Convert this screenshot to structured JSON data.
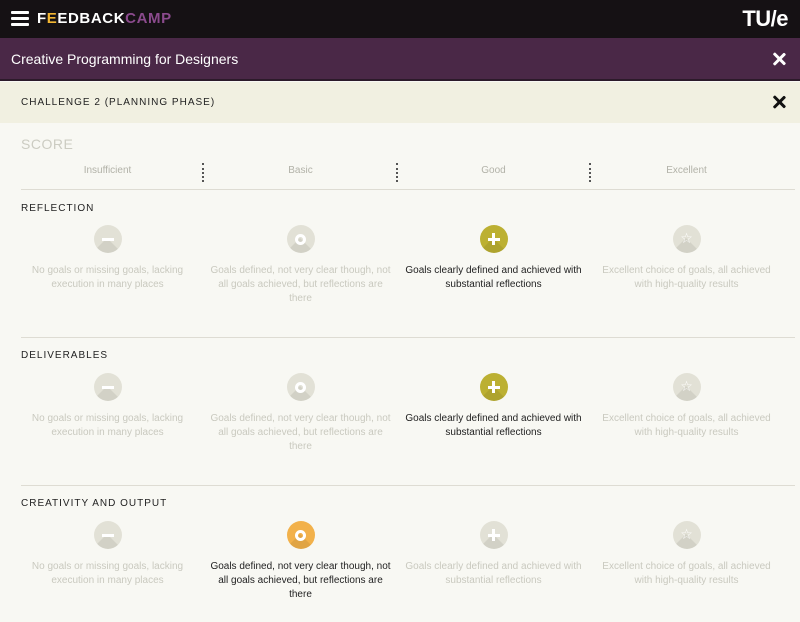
{
  "app": {
    "logo": [
      "F",
      "E",
      "EDBACK",
      "CAMP"
    ],
    "brand_right": "TU/e"
  },
  "course": {
    "title": "Creative Programming for Designers"
  },
  "challenge": {
    "title": "CHALLENGE 2 (PLANNING PHASE)"
  },
  "score": {
    "title": "SCORE",
    "levels": [
      "Insufficient",
      "Basic",
      "Good",
      "Excellent"
    ]
  },
  "criteria": [
    {
      "name": "REFLECTION",
      "selected": "Good",
      "options": [
        {
          "icon": "minus-icon",
          "text": "No goals or missing goals, lacking execution in many places"
        },
        {
          "icon": "ring-icon",
          "text": "Goals defined, not very clear though, not all goals achieved, but reflections are there"
        },
        {
          "icon": "plus-icon",
          "text": "Goals clearly defined and achieved with substantial reflections"
        },
        {
          "icon": "star-icon",
          "text": "Excellent choice of goals, all achieved with high-quality results"
        }
      ]
    },
    {
      "name": "DELIVERABLES",
      "selected": "Good",
      "options": [
        {
          "icon": "minus-icon",
          "text": "No goals or missing goals, lacking execution in many places"
        },
        {
          "icon": "ring-icon",
          "text": "Goals defined, not very clear though, not all goals achieved, but reflections are there"
        },
        {
          "icon": "plus-icon",
          "text": "Goals clearly defined and achieved with substantial reflections"
        },
        {
          "icon": "star-icon",
          "text": "Excellent choice of goals, all achieved with high-quality results"
        }
      ]
    },
    {
      "name": "CREATIVITY AND OUTPUT",
      "selected": "Basic",
      "options": [
        {
          "icon": "minus-icon",
          "text": "No goals or missing goals, lacking execution in many places"
        },
        {
          "icon": "ring-icon",
          "text": "Goals defined, not very clear though, not all goals achieved, but reflections are there"
        },
        {
          "icon": "plus-icon",
          "text": "Goals clearly defined and achieved with substantial reflections"
        },
        {
          "icon": "star-icon",
          "text": "Excellent choice of goals, all achieved with high-quality results"
        }
      ]
    }
  ],
  "colors": {
    "topbar": "#151114",
    "course_bar": "#4a2847",
    "challenge_bar": "#f1f0e1",
    "selected_good": "#bcb032",
    "selected_basic": "#f2b14a",
    "logo_accent_yellow": "#f2b632",
    "logo_accent_purple": "#8b4a8d"
  }
}
